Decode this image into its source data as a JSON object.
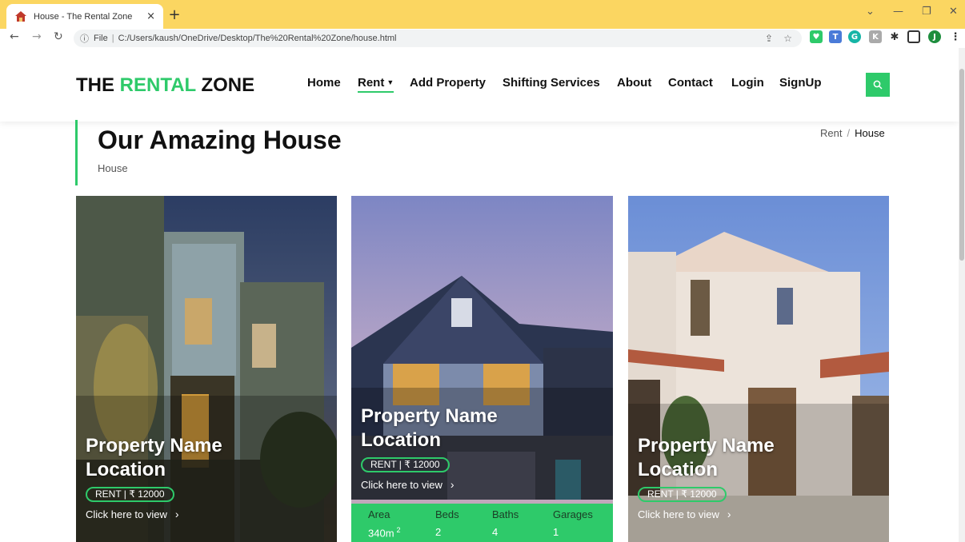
{
  "browser": {
    "tab_title": "House - The Rental Zone",
    "tab_close": "×",
    "new_tab": "+",
    "url_prefix": "File",
    "url": "C:/Users/kaush/OneDrive/Desktop/The%20Rental%20Zone/house.html",
    "profile_initial": "J"
  },
  "nav": {
    "brand_part1": "THE ",
    "brand_part2": "RENTAL",
    "brand_part3": " ZONE",
    "items": [
      {
        "label": "Home"
      },
      {
        "label": "Rent"
      },
      {
        "label": "Add Property"
      },
      {
        "label": "Shifting Services"
      },
      {
        "label": "About"
      },
      {
        "label": "Contact"
      },
      {
        "label": "Login"
      },
      {
        "label": "SignUp"
      }
    ],
    "accent_color": "#2eca6a"
  },
  "intro": {
    "title": "Our Amazing House",
    "subtitle": "House",
    "breadcrumb": [
      "Rent",
      "House"
    ],
    "breadcrumb_sep": "/"
  },
  "cards": [
    {
      "name": "Property Name",
      "location": "Location",
      "price": "RENT | ₹ 12000",
      "link": "Click here to view"
    },
    {
      "name": "Property Name",
      "location": "Location",
      "price": "RENT | ₹ 12000",
      "link": "Click here to view",
      "specs": [
        {
          "label": "Area",
          "value": "340m",
          "sup": "2"
        },
        {
          "label": "Beds",
          "value": "2"
        },
        {
          "label": "Baths",
          "value": "4"
        },
        {
          "label": "Garages",
          "value": "1"
        }
      ]
    },
    {
      "name": "Property Name",
      "location": "Location",
      "price": "RENT | ₹ 12000",
      "link": "Click here to view"
    }
  ]
}
